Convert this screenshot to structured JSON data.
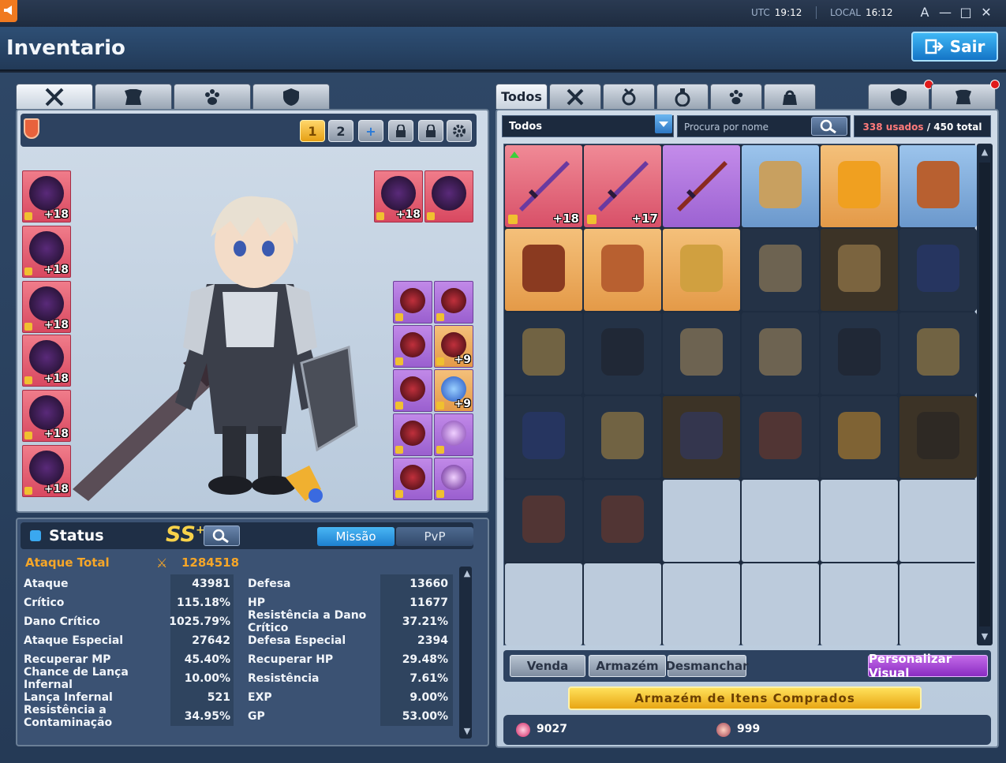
{
  "topbar": {
    "utc_label": "UTC",
    "utc_time": "19:12",
    "local_label": "LOCAL",
    "local_time": "16:12",
    "font_btn": "A",
    "minimize": "—",
    "maximize": "□",
    "close": "✕"
  },
  "header": {
    "title": "Inventario",
    "exit_label": "Sair"
  },
  "equipment": {
    "tabs": [
      "weapons-tab",
      "armor-tab",
      "pet-tab",
      "shield-tab"
    ],
    "set_buttons": [
      "1",
      "2",
      "+"
    ],
    "left_slots": [
      "+18",
      "+18",
      "+18",
      "+18",
      "+18",
      "+18"
    ],
    "weapon_slots": [
      "+18",
      ""
    ],
    "accessory_slots": [
      "",
      "",
      "",
      "+9",
      "",
      "+9",
      "",
      "",
      "",
      ""
    ]
  },
  "status": {
    "title": "Status",
    "grade": "SS",
    "grade_sup": "+",
    "tab_mission": "Missão",
    "tab_pvp": "PvP",
    "attack_total_label": "Ataque Total",
    "attack_total_value": "1284518",
    "rows": [
      {
        "l1": "Ataque",
        "v1": "43981",
        "l2": "Defesa",
        "v2": "13660"
      },
      {
        "l1": "Crítico",
        "v1": "115.18%",
        "l2": "HP",
        "v2": "11677"
      },
      {
        "l1": "Dano Crítico",
        "v1": "1025.79%",
        "l2": "Resistência a Dano Crítico",
        "v2": "37.21%"
      },
      {
        "l1": "Ataque Especial",
        "v1": "27642",
        "l2": "Defesa Especial",
        "v2": "2394"
      },
      {
        "l1": "Recuperar MP",
        "v1": "45.40%",
        "l2": "Recuperar HP",
        "v2": "29.48%"
      },
      {
        "l1": "Chance de Lança Infernal",
        "v1": "10.00%",
        "l2": "Resistência",
        "v2": "7.61%"
      },
      {
        "l1": "Lança Infernal",
        "v1": "521",
        "l2": "EXP",
        "v2": "9.00%"
      },
      {
        "l1": "Resistência a Contaminação",
        "v1": "34.95%",
        "l2": "GP",
        "v2": "53.00%"
      }
    ]
  },
  "inventory": {
    "tab_all": "Todos",
    "filter_value": "Todos",
    "search_placeholder": "Procura por nome",
    "used": "338 usados",
    "total": " / 450 total",
    "items": [
      {
        "rarity": "red",
        "plus": "+18",
        "lock": true,
        "up": true,
        "kind": "sword"
      },
      {
        "rarity": "red",
        "plus": "+17",
        "lock": true,
        "up": false,
        "kind": "sword"
      },
      {
        "rarity": "purple",
        "plus": "",
        "lock": false,
        "up": false,
        "kind": "spear"
      },
      {
        "rarity": "blue",
        "plus": "",
        "lock": false,
        "up": false,
        "kind": "glove"
      },
      {
        "rarity": "orange",
        "plus": "",
        "lock": false,
        "up": false,
        "kind": "armor"
      },
      {
        "rarity": "blue",
        "plus": "",
        "lock": false,
        "up": false,
        "kind": "mech"
      },
      {
        "rarity": "orange",
        "plus": "",
        "lock": false,
        "up": false,
        "kind": "helmet"
      },
      {
        "rarity": "orange",
        "plus": "",
        "lock": false,
        "up": false,
        "kind": "mech"
      },
      {
        "rarity": "orange",
        "plus": "",
        "lock": false,
        "up": false,
        "kind": "boot"
      },
      {
        "rarity": "dark",
        "plus": "",
        "lock": false,
        "up": false,
        "kind": "glove"
      },
      {
        "rarity": "dark-brown",
        "plus": "",
        "lock": false,
        "up": false,
        "kind": "glove"
      },
      {
        "rarity": "dark",
        "plus": "",
        "lock": false,
        "up": false,
        "kind": "cape"
      },
      {
        "rarity": "dark",
        "plus": "",
        "lock": false,
        "up": false,
        "kind": "boot"
      },
      {
        "rarity": "dark",
        "plus": "",
        "lock": false,
        "up": false,
        "kind": "pants"
      },
      {
        "rarity": "dark",
        "plus": "",
        "lock": false,
        "up": false,
        "kind": "glove"
      },
      {
        "rarity": "dark",
        "plus": "",
        "lock": false,
        "up": false,
        "kind": "glove"
      },
      {
        "rarity": "dark",
        "plus": "",
        "lock": false,
        "up": false,
        "kind": "pants"
      },
      {
        "rarity": "dark",
        "plus": "",
        "lock": false,
        "up": false,
        "kind": "boot"
      },
      {
        "rarity": "dark",
        "plus": "",
        "lock": false,
        "up": false,
        "kind": "cape"
      },
      {
        "rarity": "dark",
        "plus": "",
        "lock": false,
        "up": false,
        "kind": "boot"
      },
      {
        "rarity": "dark-brown",
        "plus": "",
        "lock": false,
        "up": false,
        "kind": "cape"
      },
      {
        "rarity": "dark",
        "plus": "",
        "lock": false,
        "up": false,
        "kind": "helmet"
      },
      {
        "rarity": "dark",
        "plus": "",
        "lock": false,
        "up": false,
        "kind": "armor"
      },
      {
        "rarity": "dark-brown",
        "plus": "",
        "lock": false,
        "up": false,
        "kind": "pants"
      },
      {
        "rarity": "dark",
        "plus": "",
        "lock": false,
        "up": false,
        "kind": "helmet"
      },
      {
        "rarity": "dark",
        "plus": "",
        "lock": false,
        "up": false,
        "kind": "helmet"
      },
      {
        "rarity": "empty"
      },
      {
        "rarity": "empty"
      },
      {
        "rarity": "empty"
      },
      {
        "rarity": "empty"
      },
      {
        "rarity": "empty"
      },
      {
        "rarity": "empty"
      },
      {
        "rarity": "empty"
      },
      {
        "rarity": "empty"
      },
      {
        "rarity": "empty"
      },
      {
        "rarity": "empty"
      }
    ],
    "btn_sell": "Venda",
    "btn_storage": "Armazém",
    "btn_dismantle": "Desmanchar",
    "btn_customize": "Personalizar Visual",
    "btn_purchased": "Armazém de Itens Comprados",
    "currency_1": "9027",
    "currency_2": "999"
  },
  "colors": {
    "accent_blue": "#1e80d0",
    "attack_orange": "#f6a628",
    "used_red": "#ff7a7a",
    "customize_purple": "#8a2cc2"
  }
}
